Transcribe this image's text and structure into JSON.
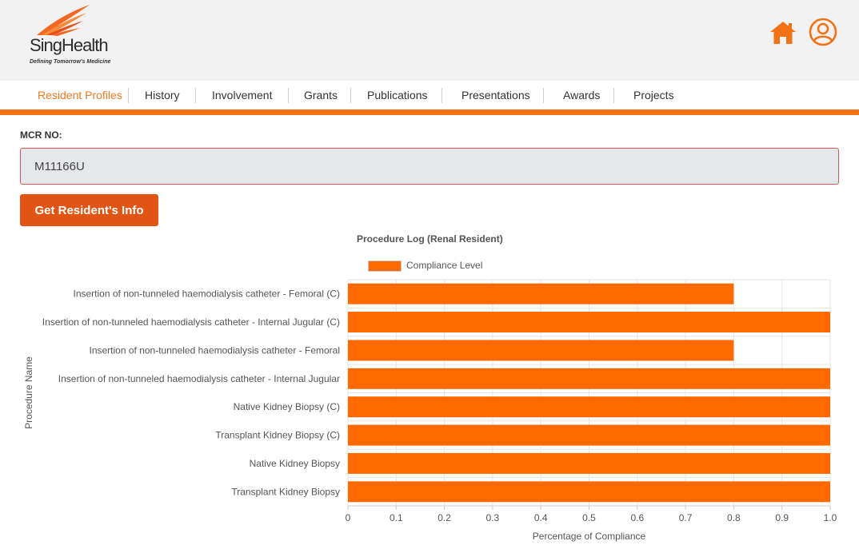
{
  "brand": {
    "name": "SingHealth",
    "tagline": "Defining Tomorrow's Medicine"
  },
  "icons": {
    "home": "home-icon",
    "user": "user-circle-icon"
  },
  "nav": {
    "items": [
      {
        "label": "Resident Profiles",
        "active": true
      },
      {
        "label": "History",
        "active": false
      },
      {
        "label": "Involvement",
        "active": false
      },
      {
        "label": "Grants",
        "active": false
      },
      {
        "label": "Publications",
        "active": false
      },
      {
        "label": "Presentations",
        "active": false
      },
      {
        "label": "Awards",
        "active": false
      },
      {
        "label": "Projects",
        "active": false
      }
    ]
  },
  "form": {
    "mcr_label": "MCR NO:",
    "mcr_value": "M11166U",
    "button_label": "Get Resident's Info"
  },
  "colors": {
    "accent": "#f47216",
    "bar": "#ff6a00",
    "button": "#e25413"
  },
  "chart_data": {
    "type": "bar",
    "orientation": "horizontal",
    "title": "Procedure Log (Renal Resident)",
    "xlabel": "Percentage of Compliance",
    "ylabel": "Procedure Name",
    "xlim": [
      0,
      1.0
    ],
    "xticks": [
      "0",
      "0.1",
      "0.2",
      "0.3",
      "0.4",
      "0.5",
      "0.6",
      "0.7",
      "0.8",
      "0.9",
      "1.0"
    ],
    "grid": true,
    "legend_position": "top",
    "categories": [
      "Insertion of non-tunneled haemodialysis catheter - Femoral (C)",
      "Insertion of non-tunneled haemodialysis catheter - Internal Jugular (C)",
      "Insertion of non-tunneled haemodialysis catheter - Femoral",
      "Insertion of non-tunneled haemodialysis catheter - Internal Jugular",
      "Native Kidney Biopsy (C)",
      "Transplant Kidney Biopsy (C)",
      "Native Kidney Biopsy",
      "Transplant Kidney Biopsy"
    ],
    "series": [
      {
        "name": "Compliance Level",
        "values": [
          0.8,
          1.0,
          0.8,
          1.0,
          1.0,
          1.0,
          1.0,
          1.0
        ]
      }
    ]
  }
}
